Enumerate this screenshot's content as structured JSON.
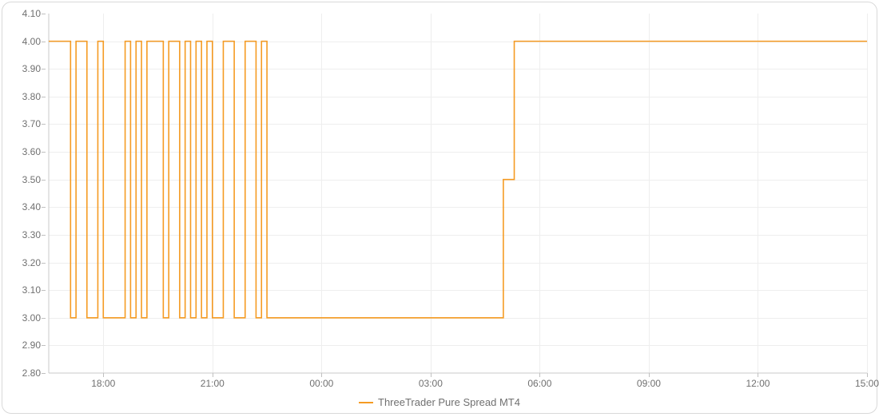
{
  "chart_data": {
    "type": "line",
    "title": "",
    "xlabel": "",
    "ylabel": "",
    "ylim": [
      2.8,
      4.1
    ],
    "y_ticks": [
      2.8,
      2.9,
      3.0,
      3.1,
      3.2,
      3.3,
      3.4,
      3.5,
      3.6,
      3.7,
      3.8,
      3.9,
      4.0,
      4.1
    ],
    "x_ticks": [
      "18:00",
      "21:00",
      "00:00",
      "03:00",
      "06:00",
      "09:00",
      "12:00",
      "15:00"
    ],
    "x_range_hours": [
      16.5,
      39.0
    ],
    "grid": {
      "horizontal": true,
      "vertical": true
    },
    "legend_position": "bottom",
    "series": [
      {
        "name": "ThreeTrader Pure Spread MT4",
        "color": "#f59b23",
        "x_hours": [
          16.5,
          17.1,
          17.1,
          17.25,
          17.25,
          17.55,
          17.55,
          17.85,
          17.85,
          18.0,
          18.0,
          18.6,
          18.6,
          18.75,
          18.75,
          18.9,
          18.9,
          19.05,
          19.05,
          19.2,
          19.2,
          19.65,
          19.65,
          19.8,
          19.8,
          20.1,
          20.1,
          20.25,
          20.25,
          20.4,
          20.4,
          20.55,
          20.55,
          20.7,
          20.7,
          20.85,
          20.85,
          21.0,
          21.0,
          21.3,
          21.3,
          21.6,
          21.6,
          21.9,
          21.9,
          22.2,
          22.2,
          22.35,
          22.35,
          22.5,
          22.5,
          29.0,
          29.0,
          29.3,
          29.3,
          39.0
        ],
        "values": [
          4.0,
          4.0,
          3.0,
          3.0,
          4.0,
          4.0,
          3.0,
          3.0,
          4.0,
          4.0,
          3.0,
          3.0,
          4.0,
          4.0,
          3.0,
          3.0,
          4.0,
          4.0,
          3.0,
          3.0,
          4.0,
          4.0,
          3.0,
          3.0,
          4.0,
          4.0,
          3.0,
          3.0,
          4.0,
          4.0,
          3.0,
          3.0,
          4.0,
          4.0,
          3.0,
          3.0,
          4.0,
          4.0,
          3.0,
          3.0,
          4.0,
          4.0,
          3.0,
          3.0,
          4.0,
          4.0,
          3.0,
          3.0,
          4.0,
          4.0,
          3.0,
          3.0,
          3.5,
          3.5,
          4.0,
          4.0
        ]
      }
    ]
  },
  "y_tick_labels": [
    "2.80",
    "2.90",
    "3.00",
    "3.10",
    "3.20",
    "3.30",
    "3.40",
    "3.50",
    "3.60",
    "3.70",
    "3.80",
    "3.90",
    "4.00",
    "4.10"
  ],
  "x_tick_labels": [
    "18:00",
    "21:00",
    "00:00",
    "03:00",
    "06:00",
    "09:00",
    "12:00",
    "15:00"
  ],
  "legend": {
    "items": [
      {
        "label": "ThreeTrader Pure Spread MT4"
      }
    ]
  }
}
